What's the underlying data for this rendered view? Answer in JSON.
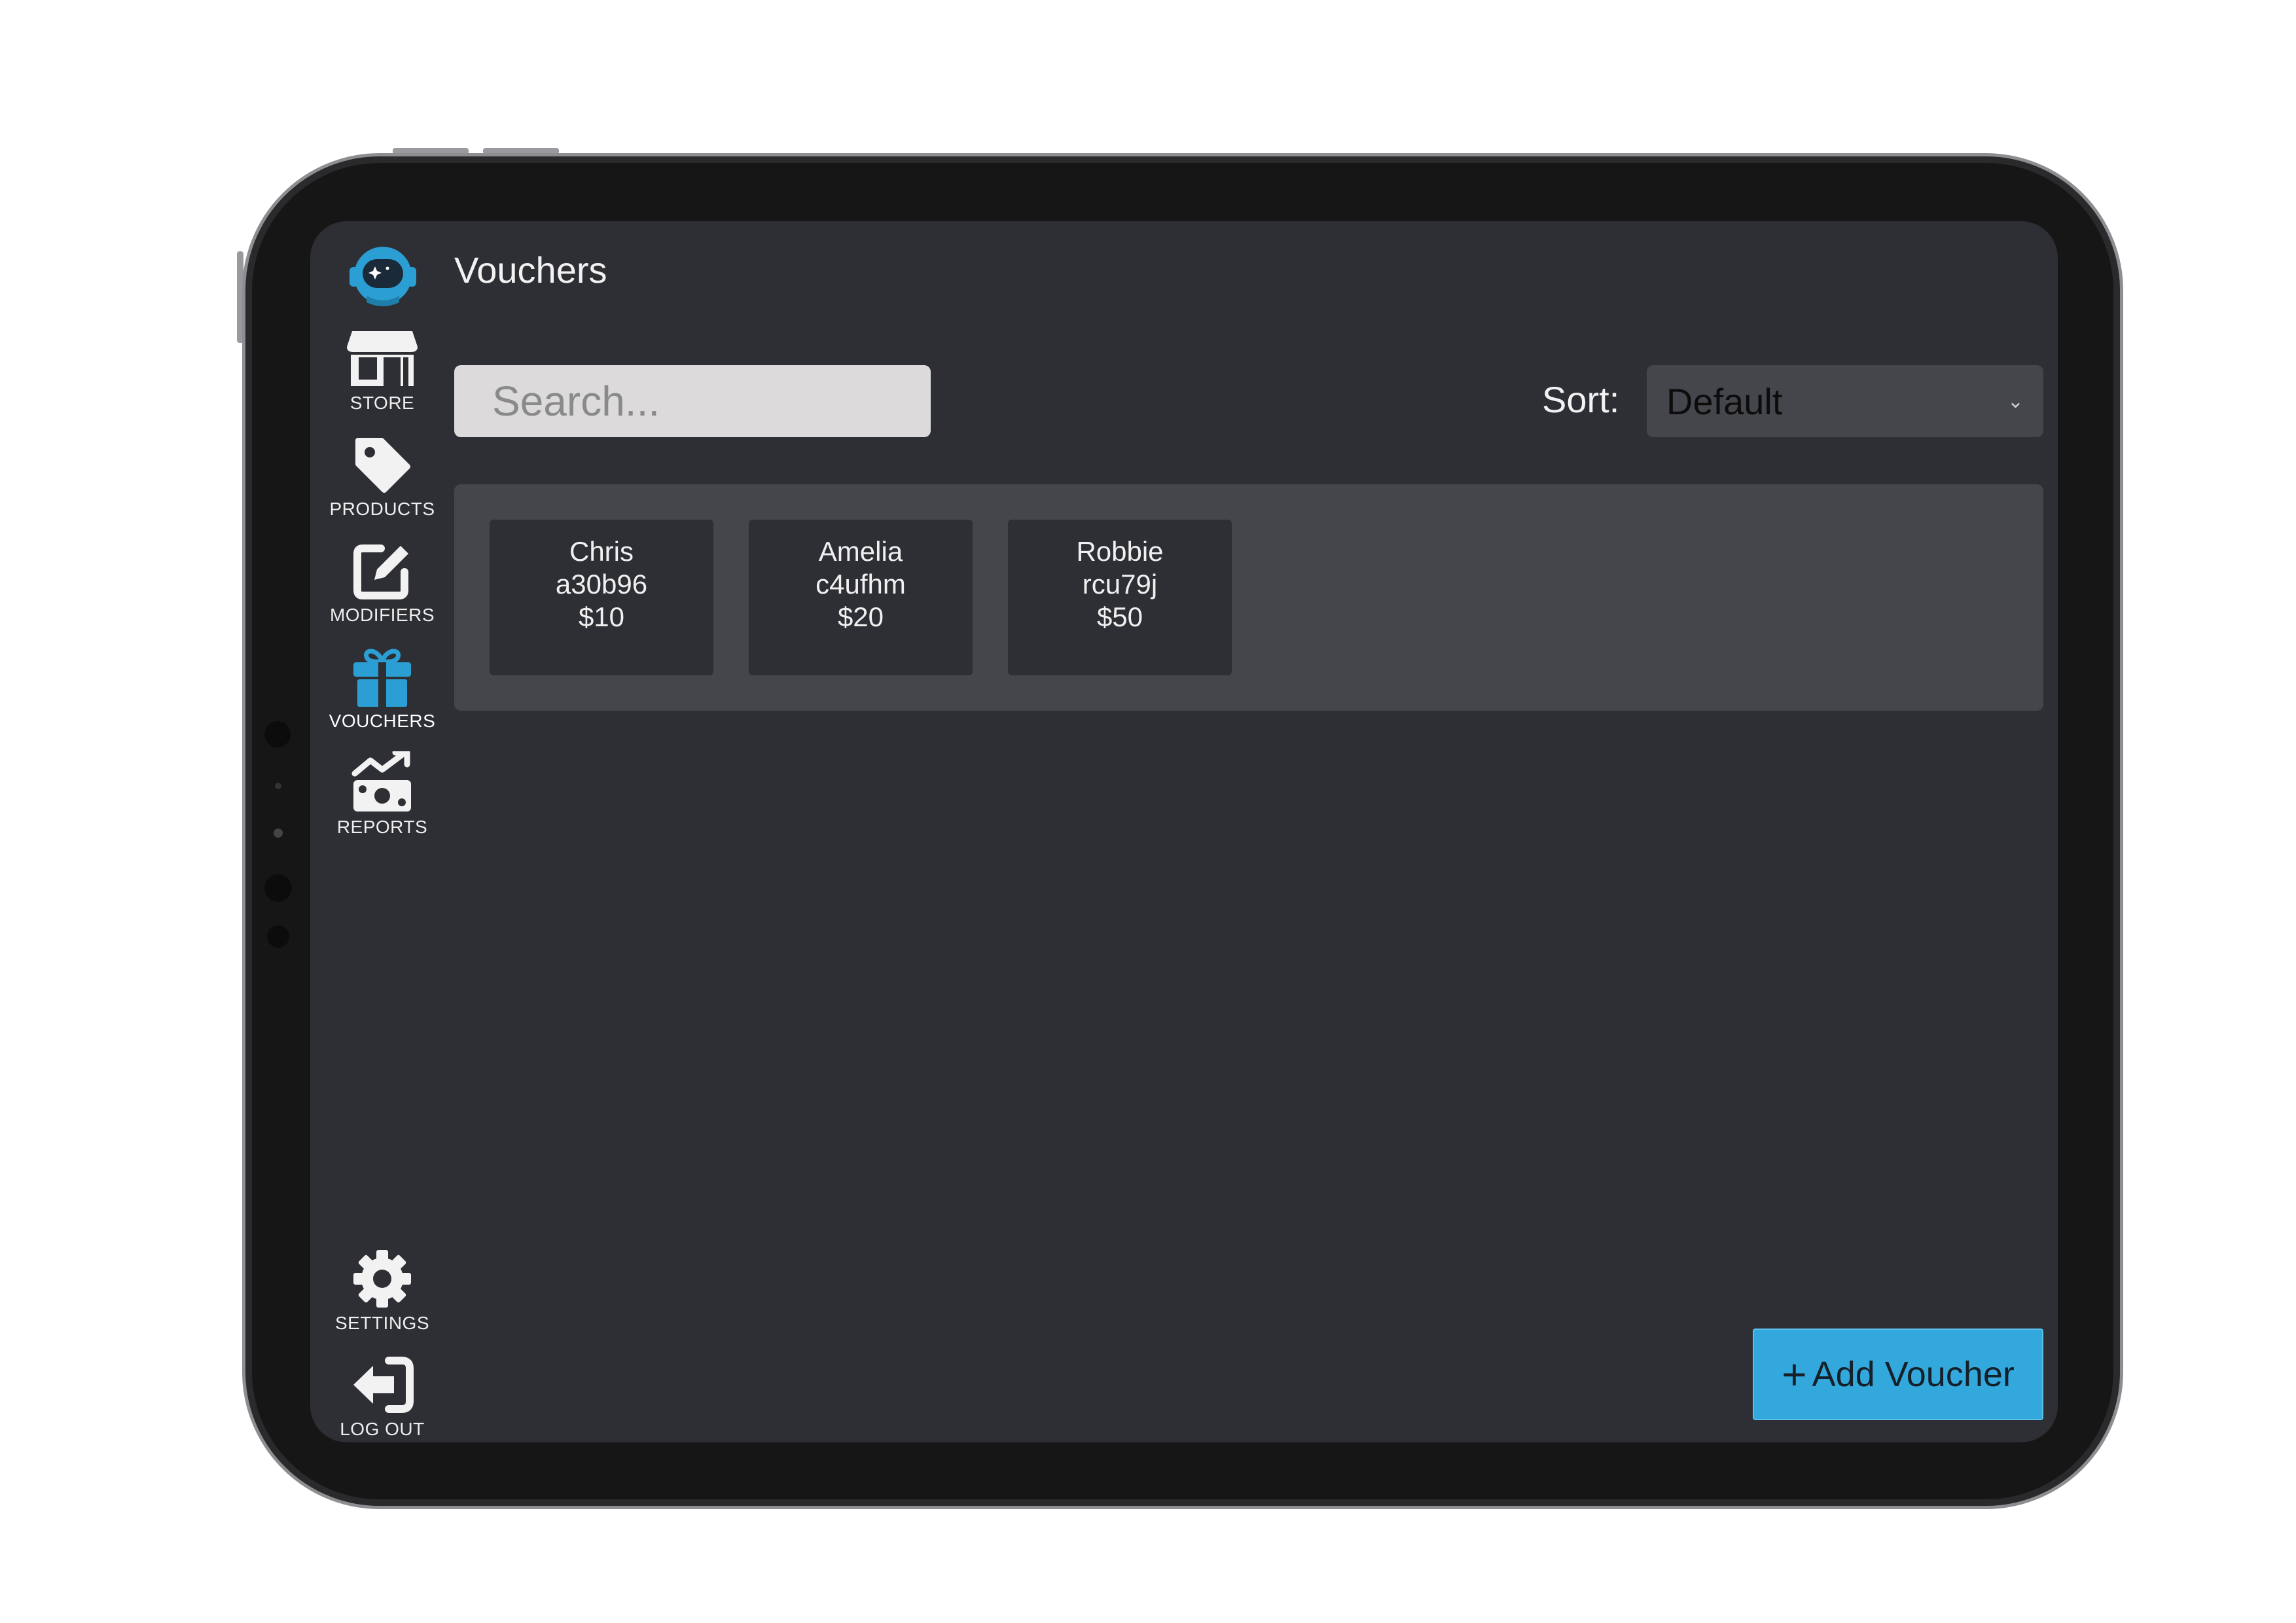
{
  "app": {
    "page_title": "Vouchers"
  },
  "sidebar": {
    "items": [
      {
        "label": "STORE",
        "icon": "store-icon"
      },
      {
        "label": "PRODUCTS",
        "icon": "tag-icon"
      },
      {
        "label": "MODIFIERS",
        "icon": "edit-icon"
      },
      {
        "label": "VOUCHERS",
        "icon": "gift-icon",
        "active": true
      },
      {
        "label": "REPORTS",
        "icon": "reports-icon"
      }
    ],
    "bottom_items": [
      {
        "label": "SETTINGS",
        "icon": "gear-icon"
      },
      {
        "label": "LOG OUT",
        "icon": "logout-icon"
      }
    ]
  },
  "search": {
    "placeholder": "Search..."
  },
  "sort": {
    "label": "Sort:",
    "selected": "Default"
  },
  "vouchers": [
    {
      "name": "Chris",
      "code": "a30b96",
      "amount": "$10"
    },
    {
      "name": "Amelia",
      "code": "c4ufhm",
      "amount": "$20"
    },
    {
      "name": "Robbie",
      "code": "rcu79j",
      "amount": "$50"
    }
  ],
  "actions": {
    "add_voucher": "Add Voucher"
  },
  "colors": {
    "accent": "#33a8dc",
    "background": "#2e2f34",
    "panel": "#45464b"
  }
}
